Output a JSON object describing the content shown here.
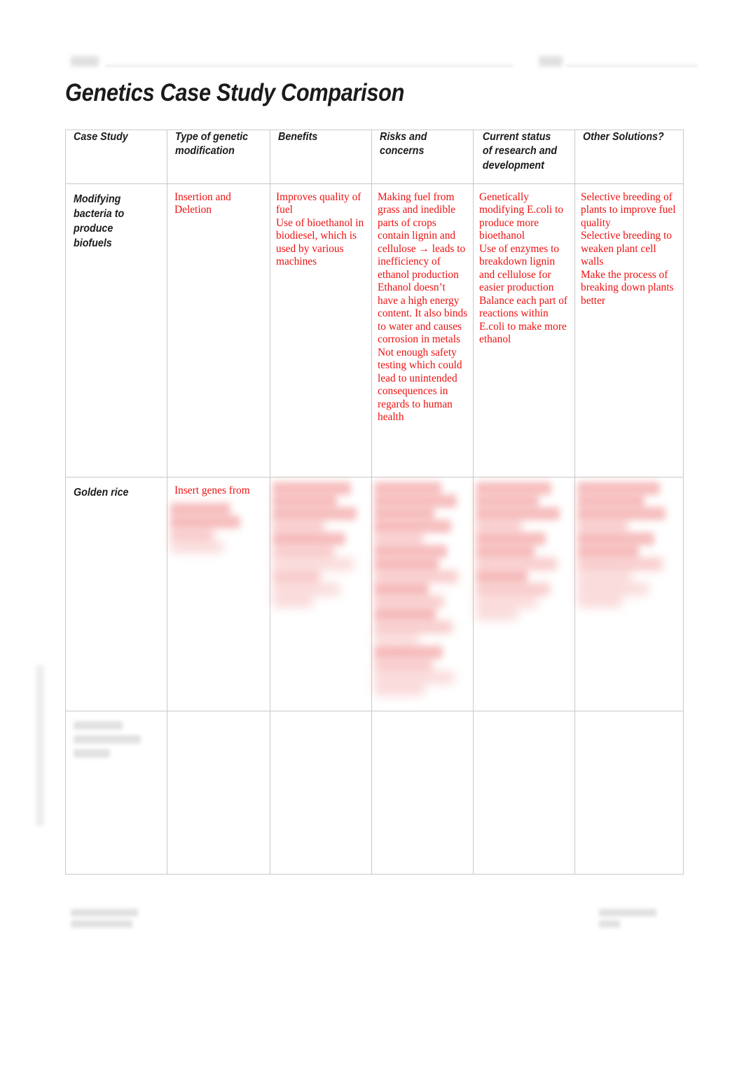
{
  "document": {
    "title": "Genetics Case Study Comparison",
    "red_text_color": "#ee1111",
    "heading_text_color": "#1b1b1b"
  },
  "header": {
    "left_label_redacted": "",
    "right_label_redacted": ""
  },
  "table": {
    "headers": [
      "Case Study",
      "Type of genetic modification",
      "Benefits",
      "Risks and concerns",
      "Current status of research and development",
      "Other Solutions?"
    ],
    "rows": [
      {
        "case_study": "Modifying bacteria to produce biofuels",
        "type_of_modification": "Insertion and Deletion",
        "benefits": "Improves quality of fuel\nUse of bioethanol in biodiesel, which is used by various machines",
        "risks_and_concerns": "Making fuel from grass and inedible parts of crops contain lignin and cellulose → leads to inefficiency of ethanol production\nEthanol doesn’t have a high energy content. It also binds to water and causes corrosion in metals\nNot enough safety testing which could lead to unintended consequences in regards to human health",
        "current_status": "Genetically modifying E.coli to produce more bioethanol\nUse of enzymes to breakdown lignin and cellulose for easier production\nBalance each part of reactions within E.coli to make more ethanol",
        "other_solutions": "Selective breeding of plants to improve fuel quality\nSelective breeding to weaken plant cell walls\nMake the process of breaking down plants better"
      },
      {
        "case_study": "Golden rice",
        "type_of_modification": "Insert genes from",
        "benefits": "",
        "risks_and_concerns": "",
        "current_status": "",
        "other_solutions": ""
      },
      {
        "case_study": "",
        "type_of_modification": "",
        "benefits": "",
        "risks_and_concerns": "",
        "current_status": "",
        "other_solutions": ""
      }
    ]
  },
  "footer": {
    "left_redacted": "",
    "right_redacted": ""
  }
}
